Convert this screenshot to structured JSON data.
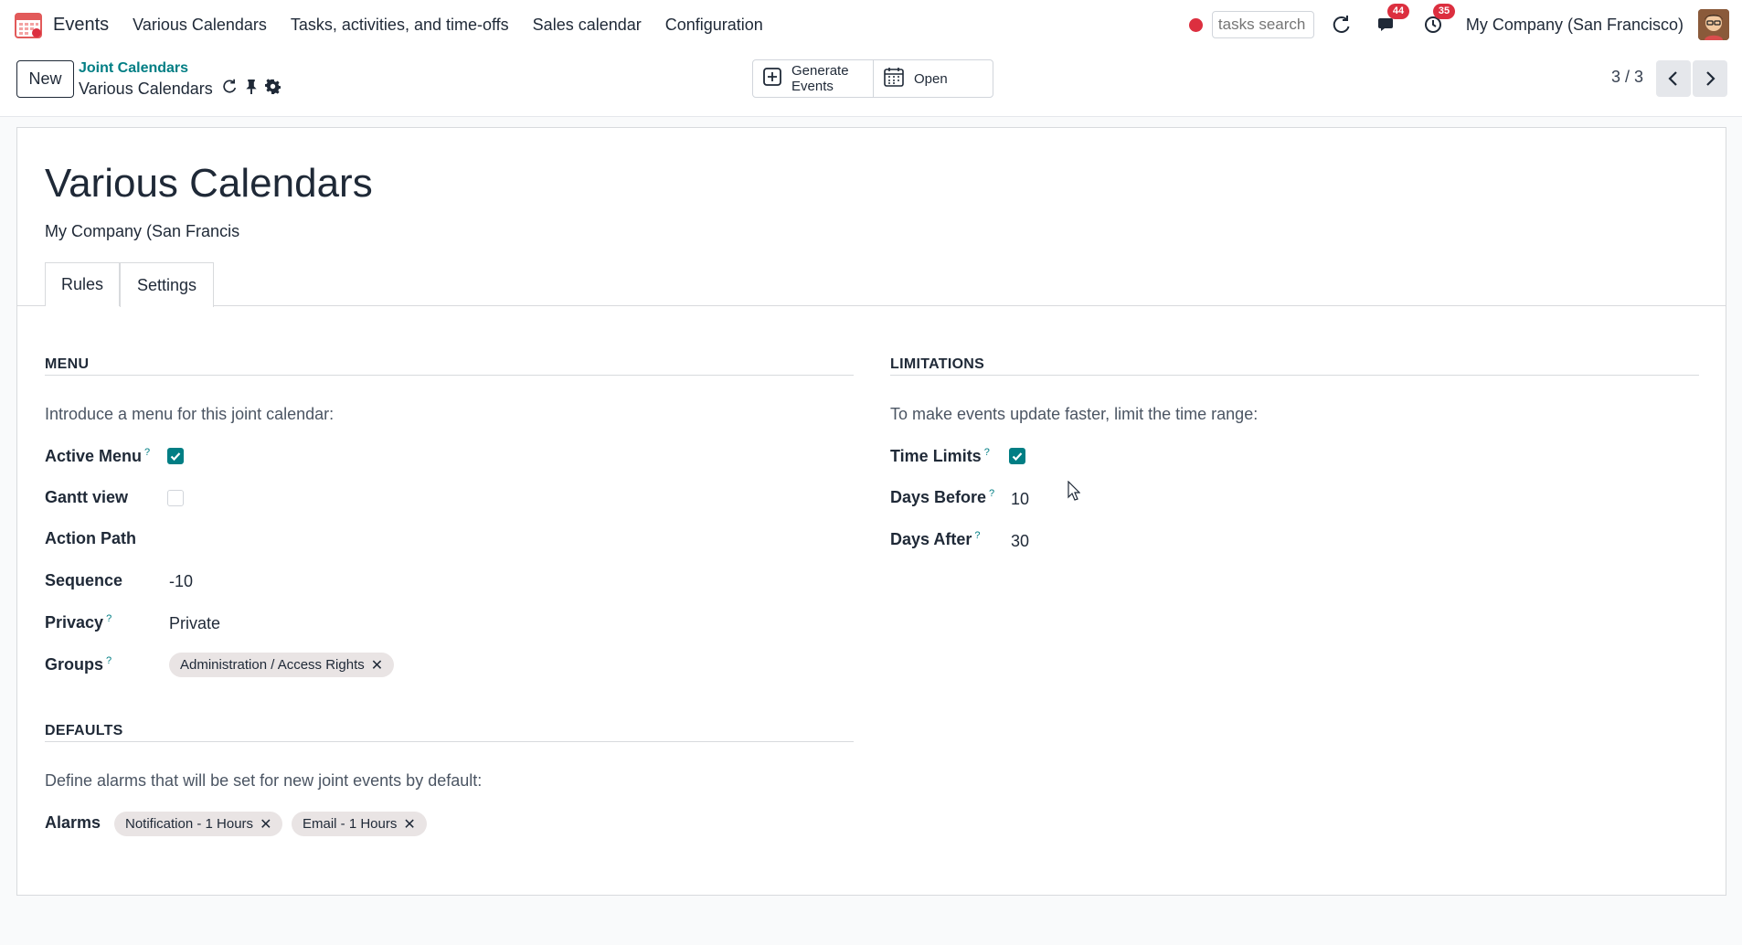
{
  "navbar": {
    "app_name": "Events",
    "menus": [
      "Various Calendars",
      "Tasks, activities, and time-offs",
      "Sales calendar",
      "Configuration"
    ],
    "search_placeholder": "tasks search",
    "messages_badge": "44",
    "activities_badge": "35",
    "company": "My Company (San Francisco)",
    "icons": {
      "logo": "calendar-app-icon",
      "record": "record-dot-icon",
      "discuss": "refresh-icon",
      "messages": "chat-icon",
      "activities": "clock-icon"
    }
  },
  "control_panel": {
    "new_label": "New",
    "breadcrumb_parent": "Joint Calendars",
    "breadcrumb_current": "Various Calendars",
    "actions": [
      {
        "label_line1": "Generate",
        "label_line2": "Events",
        "icon": "plus-square-icon"
      },
      {
        "label_line1": "Open",
        "label_line2": "",
        "icon": "calendar-icon"
      }
    ],
    "pager": "3 / 3"
  },
  "form": {
    "title": "Various Calendars",
    "company": "My Company (San Francis",
    "tabs": [
      "Rules",
      "Settings"
    ],
    "active_tab": "Settings",
    "menu_section": {
      "title": "MENU",
      "help": "Introduce a menu for this joint calendar:",
      "active_menu_label": "Active Menu",
      "active_menu_checked": true,
      "gantt_label": "Gantt view",
      "gantt_checked": false,
      "action_path_label": "Action Path",
      "sequence_label": "Sequence",
      "sequence_value": "-10",
      "privacy_label": "Privacy",
      "privacy_value": "Private",
      "groups_label": "Groups",
      "groups": [
        "Administration / Access Rights"
      ]
    },
    "limitations_section": {
      "title": "LIMITATIONS",
      "help": "To make events update faster, limit the time range:",
      "time_limits_label": "Time Limits",
      "time_limits_checked": true,
      "days_before_label": "Days Before",
      "days_before_value": "10",
      "days_after_label": "Days After",
      "days_after_value": "30"
    },
    "defaults_section": {
      "title": "DEFAULTS",
      "help": "Define alarms that will be set for new joint events by default:",
      "alarms_label": "Alarms",
      "alarms": [
        "Notification - 1 Hours",
        "Email - 1 Hours"
      ]
    },
    "help_marker": "?",
    "tag_remove": "✕"
  },
  "colors": {
    "accent": "#017e84",
    "badge": "#dc2f3f",
    "tag_bg": "#e9e4e4"
  }
}
